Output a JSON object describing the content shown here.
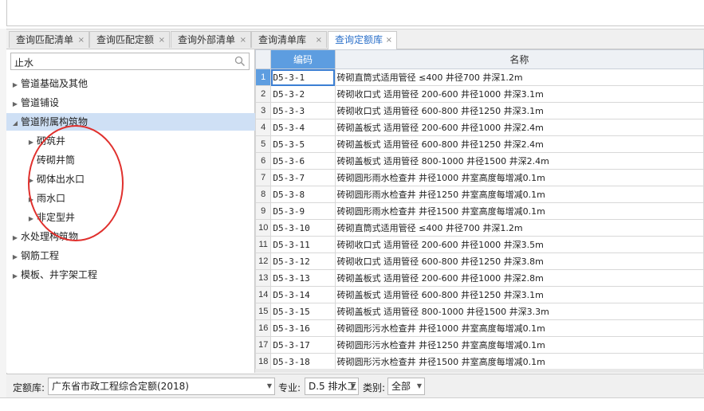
{
  "tabs": [
    {
      "label": "查询匹配清单",
      "active": false
    },
    {
      "label": "查询匹配定额",
      "active": false
    },
    {
      "label": "查询外部清单",
      "active": false
    },
    {
      "label": "查询清单库",
      "active": false
    },
    {
      "label": "查询定额库",
      "active": true
    }
  ],
  "tab_close_glyph": "×",
  "search": {
    "value": "止水",
    "icon": "search-icon"
  },
  "tree": [
    {
      "label": "管道基础及其他",
      "level": 0,
      "expandable": true,
      "expanded": false,
      "selected": false
    },
    {
      "label": "管道铺设",
      "level": 0,
      "expandable": true,
      "expanded": false,
      "selected": false
    },
    {
      "label": "管道附属构筑物",
      "level": 0,
      "expandable": true,
      "expanded": true,
      "selected": true
    },
    {
      "label": "砌筑井",
      "level": 1,
      "expandable": true,
      "expanded": false,
      "selected": false
    },
    {
      "label": "砖砌井筒",
      "level": 1,
      "expandable": false,
      "expanded": false,
      "selected": false
    },
    {
      "label": "砌体出水口",
      "level": 1,
      "expandable": true,
      "expanded": false,
      "selected": false
    },
    {
      "label": "雨水口",
      "level": 1,
      "expandable": true,
      "expanded": false,
      "selected": false
    },
    {
      "label": "非定型井",
      "level": 1,
      "expandable": true,
      "expanded": false,
      "selected": false
    },
    {
      "label": "水处理构筑物",
      "level": 0,
      "expandable": true,
      "expanded": false,
      "selected": false
    },
    {
      "label": "钢筋工程",
      "level": 0,
      "expandable": true,
      "expanded": false,
      "selected": false
    },
    {
      "label": "模板、井字架工程",
      "level": 0,
      "expandable": true,
      "expanded": false,
      "selected": false
    }
  ],
  "table": {
    "headers": {
      "code": "编码",
      "name": "名称"
    },
    "rows": [
      {
        "n": "1",
        "code": "D5-3-1",
        "name": "砖砌直筒式适用管径 ≤400 井径700 井深1.2m"
      },
      {
        "n": "2",
        "code": "D5-3-2",
        "name": "砖砌收口式 适用管径 200-600 井径1000 井深3.1m"
      },
      {
        "n": "3",
        "code": "D5-3-3",
        "name": "砖砌收口式 适用管径 600-800 井径1250 井深3.1m"
      },
      {
        "n": "4",
        "code": "D5-3-4",
        "name": "砖砌盖板式 适用管径 200-600 井径1000 井深2.4m"
      },
      {
        "n": "5",
        "code": "D5-3-5",
        "name": "砖砌盖板式 适用管径 600-800 井径1250 井深2.4m"
      },
      {
        "n": "6",
        "code": "D5-3-6",
        "name": "砖砌盖板式 适用管径 800-1000 井径1500 井深2.4m"
      },
      {
        "n": "7",
        "code": "D5-3-7",
        "name": "砖砌圆形雨水检查井 井径1000 井室高度每增减0.1m"
      },
      {
        "n": "8",
        "code": "D5-3-8",
        "name": "砖砌圆形雨水检查井 井径1250 井室高度每增减0.1m"
      },
      {
        "n": "9",
        "code": "D5-3-9",
        "name": "砖砌圆形雨水检查井 井径1500 井室高度每增减0.1m"
      },
      {
        "n": "10",
        "code": "D5-3-10",
        "name": "砖砌直筒式适用管径 ≤400 井径700 井深1.2m"
      },
      {
        "n": "11",
        "code": "D5-3-11",
        "name": "砖砌收口式 适用管径 200-600 井径1000 井深3.5m"
      },
      {
        "n": "12",
        "code": "D5-3-12",
        "name": "砖砌收口式 适用管径 600-800 井径1250 井深3.8m"
      },
      {
        "n": "13",
        "code": "D5-3-13",
        "name": "砖砌盖板式 适用管径 200-600 井径1000 井深2.8m"
      },
      {
        "n": "14",
        "code": "D5-3-14",
        "name": "砖砌盖板式 适用管径 600-800 井径1250 井深3.1m"
      },
      {
        "n": "15",
        "code": "D5-3-15",
        "name": "砖砌盖板式 适用管径 800-1000 井径1500 井深3.3m"
      },
      {
        "n": "16",
        "code": "D5-3-16",
        "name": "砖砌圆形污水检查井 井径1000 井室高度每增减0.1m"
      },
      {
        "n": "17",
        "code": "D5-3-17",
        "name": "砖砌圆形污水检查井 井径1250 井室高度每增减0.1m"
      },
      {
        "n": "18",
        "code": "D5-3-18",
        "name": "砖砌圆形污水检查井 井径1500 井室高度每增减0.1m"
      }
    ]
  },
  "bottom": {
    "library_label": "定额库:",
    "library_value": "广东省市政工程综合定额(2018)",
    "specialty_label": "专业:",
    "specialty_value": "D.5 排水工",
    "category_label": "类别:",
    "category_value": "全部"
  },
  "colors": {
    "accent": "#2a6fc9",
    "header_blue": "#5d9de0",
    "annotation_red": "#e0302d"
  }
}
